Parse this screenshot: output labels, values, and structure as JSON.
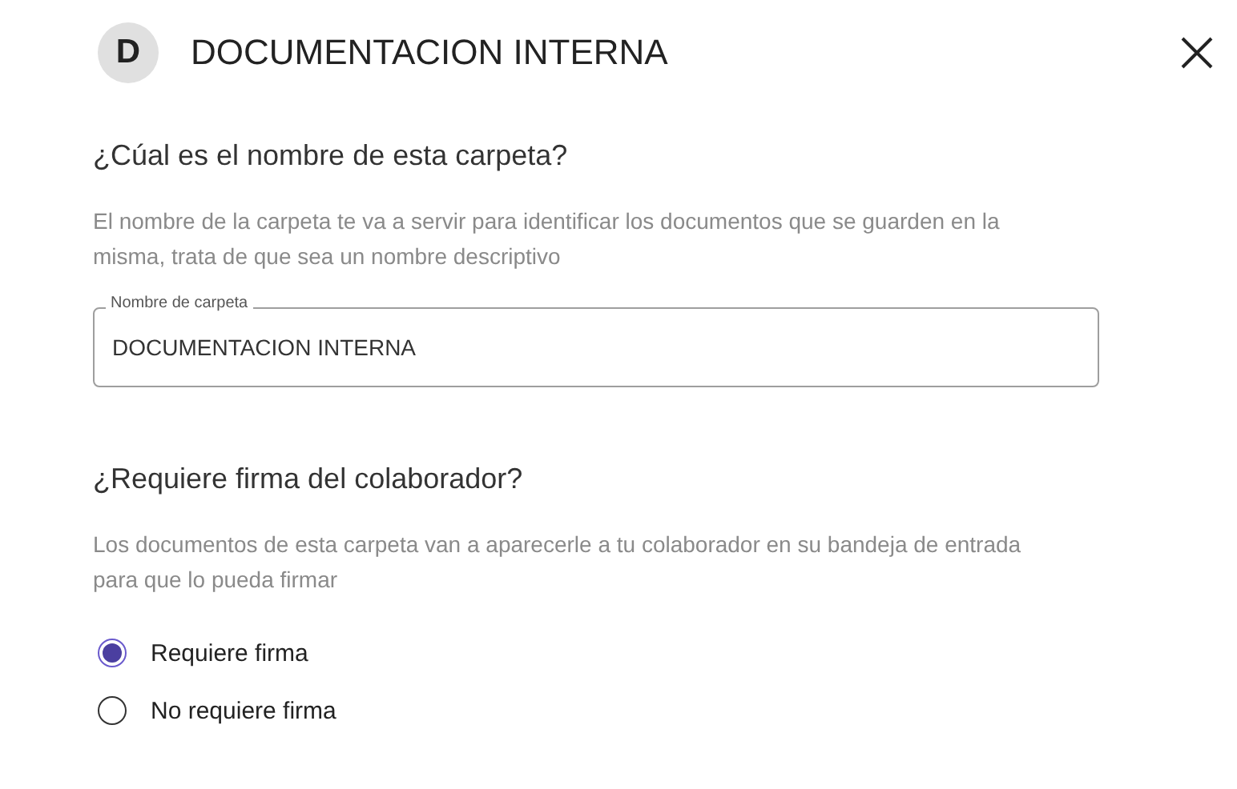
{
  "header": {
    "avatar": "D",
    "title": "DOCUMENTACION INTERNA"
  },
  "name_section": {
    "heading": "¿Cúal es el nombre de esta carpeta?",
    "description": "El nombre de la carpeta te va a servir para identificar los documentos que se guarden en la misma, trata de que sea un nombre descriptivo",
    "field": {
      "label": "Nombre de carpeta",
      "value": "DOCUMENTACION INTERNA"
    }
  },
  "signature_section": {
    "heading": "¿Requiere firma del colaborador?",
    "description": "Los documentos de esta carpeta van a aparecerle a tu colaborador en su bandeja de entrada para que lo pueda firmar",
    "options": [
      {
        "label": "Requiere firma",
        "selected": true
      },
      {
        "label": "No requiere firma",
        "selected": false
      }
    ]
  }
}
